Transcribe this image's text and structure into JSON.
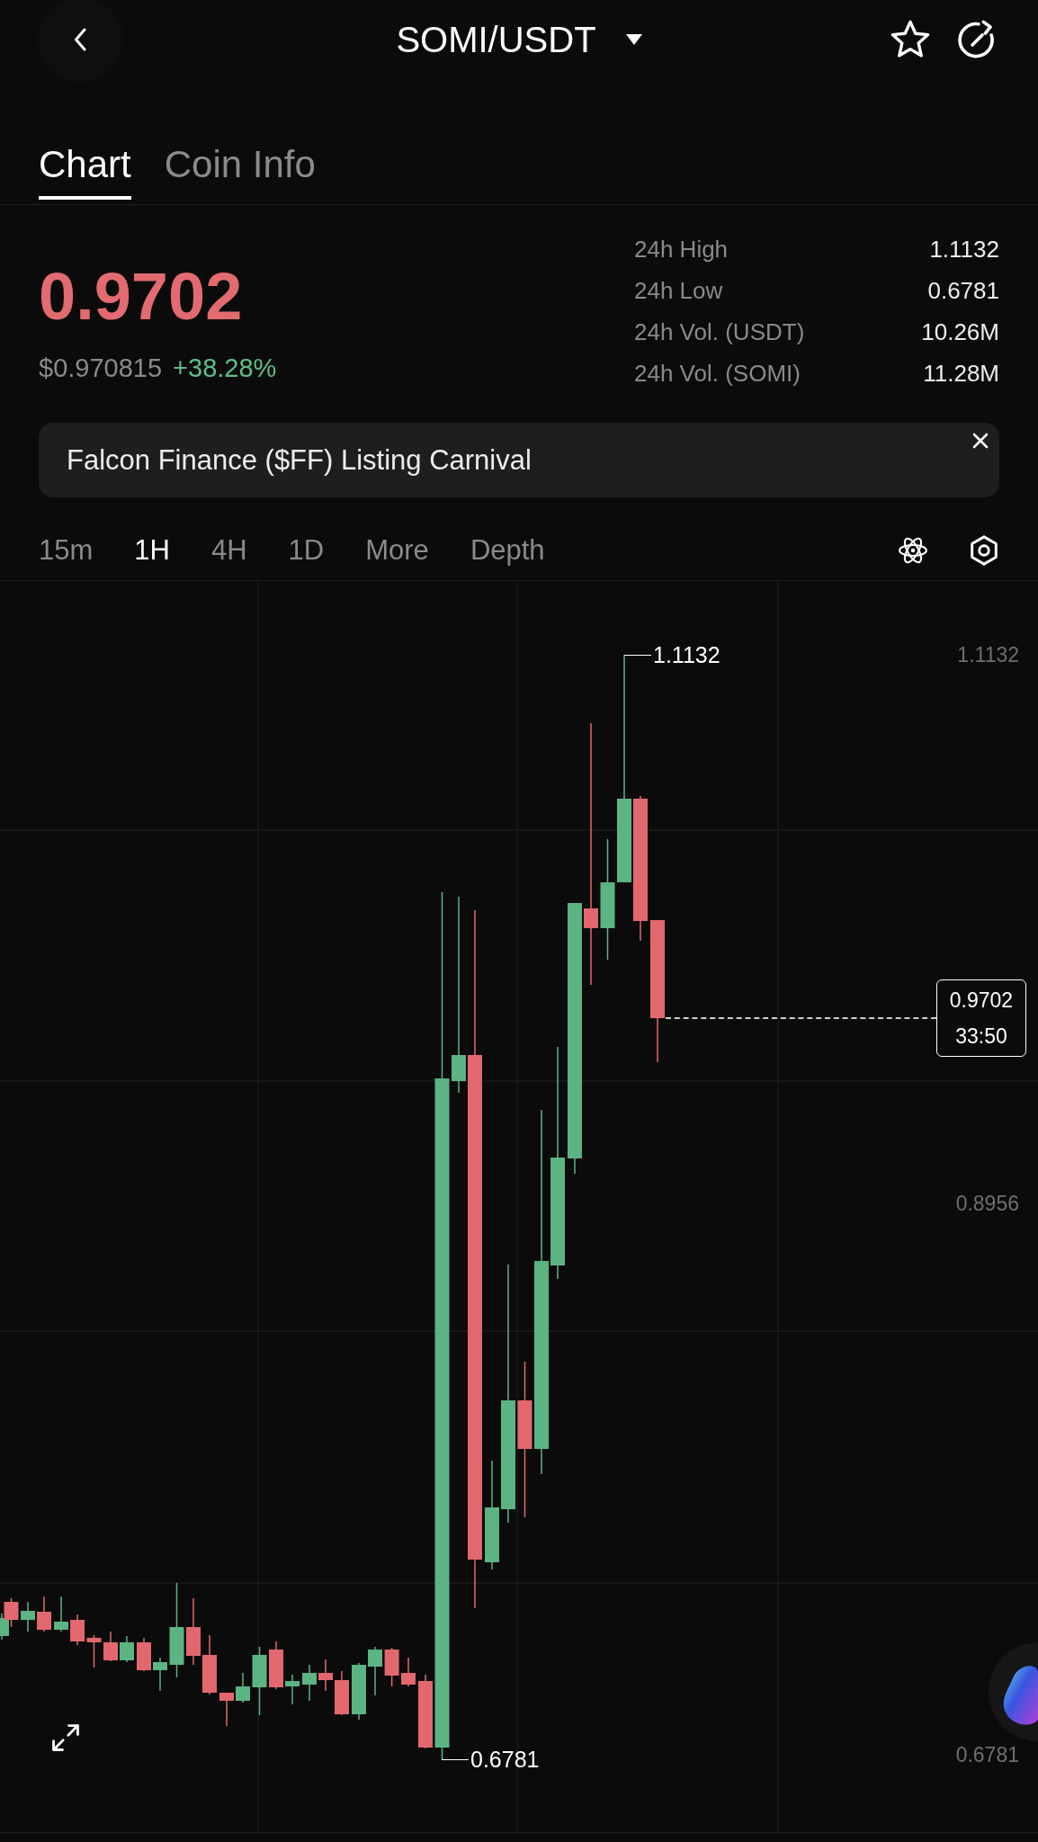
{
  "header": {
    "title": "SOMI/USDT"
  },
  "tabs": [
    {
      "label": "Chart",
      "selected": true
    },
    {
      "label": "Coin Info",
      "selected": false
    }
  ],
  "ticker": {
    "last_price": "0.9702",
    "price_falling": true,
    "fiat_price": "$0.970815",
    "change": "+38.28%",
    "change_rising": true
  },
  "stats": [
    {
      "label": "24h High",
      "value": "1.1132"
    },
    {
      "label": "24h Low",
      "value": "0.6781"
    },
    {
      "label": "24h Vol. (USDT)",
      "value": "10.26M"
    },
    {
      "label": "24h Vol. (SOMI)",
      "value": "11.28M"
    }
  ],
  "banner": {
    "text": "Falcon Finance ($FF) Listing Carnival"
  },
  "intervals": [
    {
      "label": "15m",
      "selected": false
    },
    {
      "label": "1H",
      "selected": true
    },
    {
      "label": "4H",
      "selected": false
    },
    {
      "label": "1D",
      "selected": false
    },
    {
      "label": "More",
      "selected": false
    },
    {
      "label": "Depth",
      "selected": false
    }
  ],
  "chart": {
    "price_axis": [
      "1.1132",
      "0.8956",
      "0.6781"
    ],
    "high_label": "1.1132",
    "low_label": "0.6781",
    "current_price": "0.9702",
    "countdown": "33:50"
  }
}
